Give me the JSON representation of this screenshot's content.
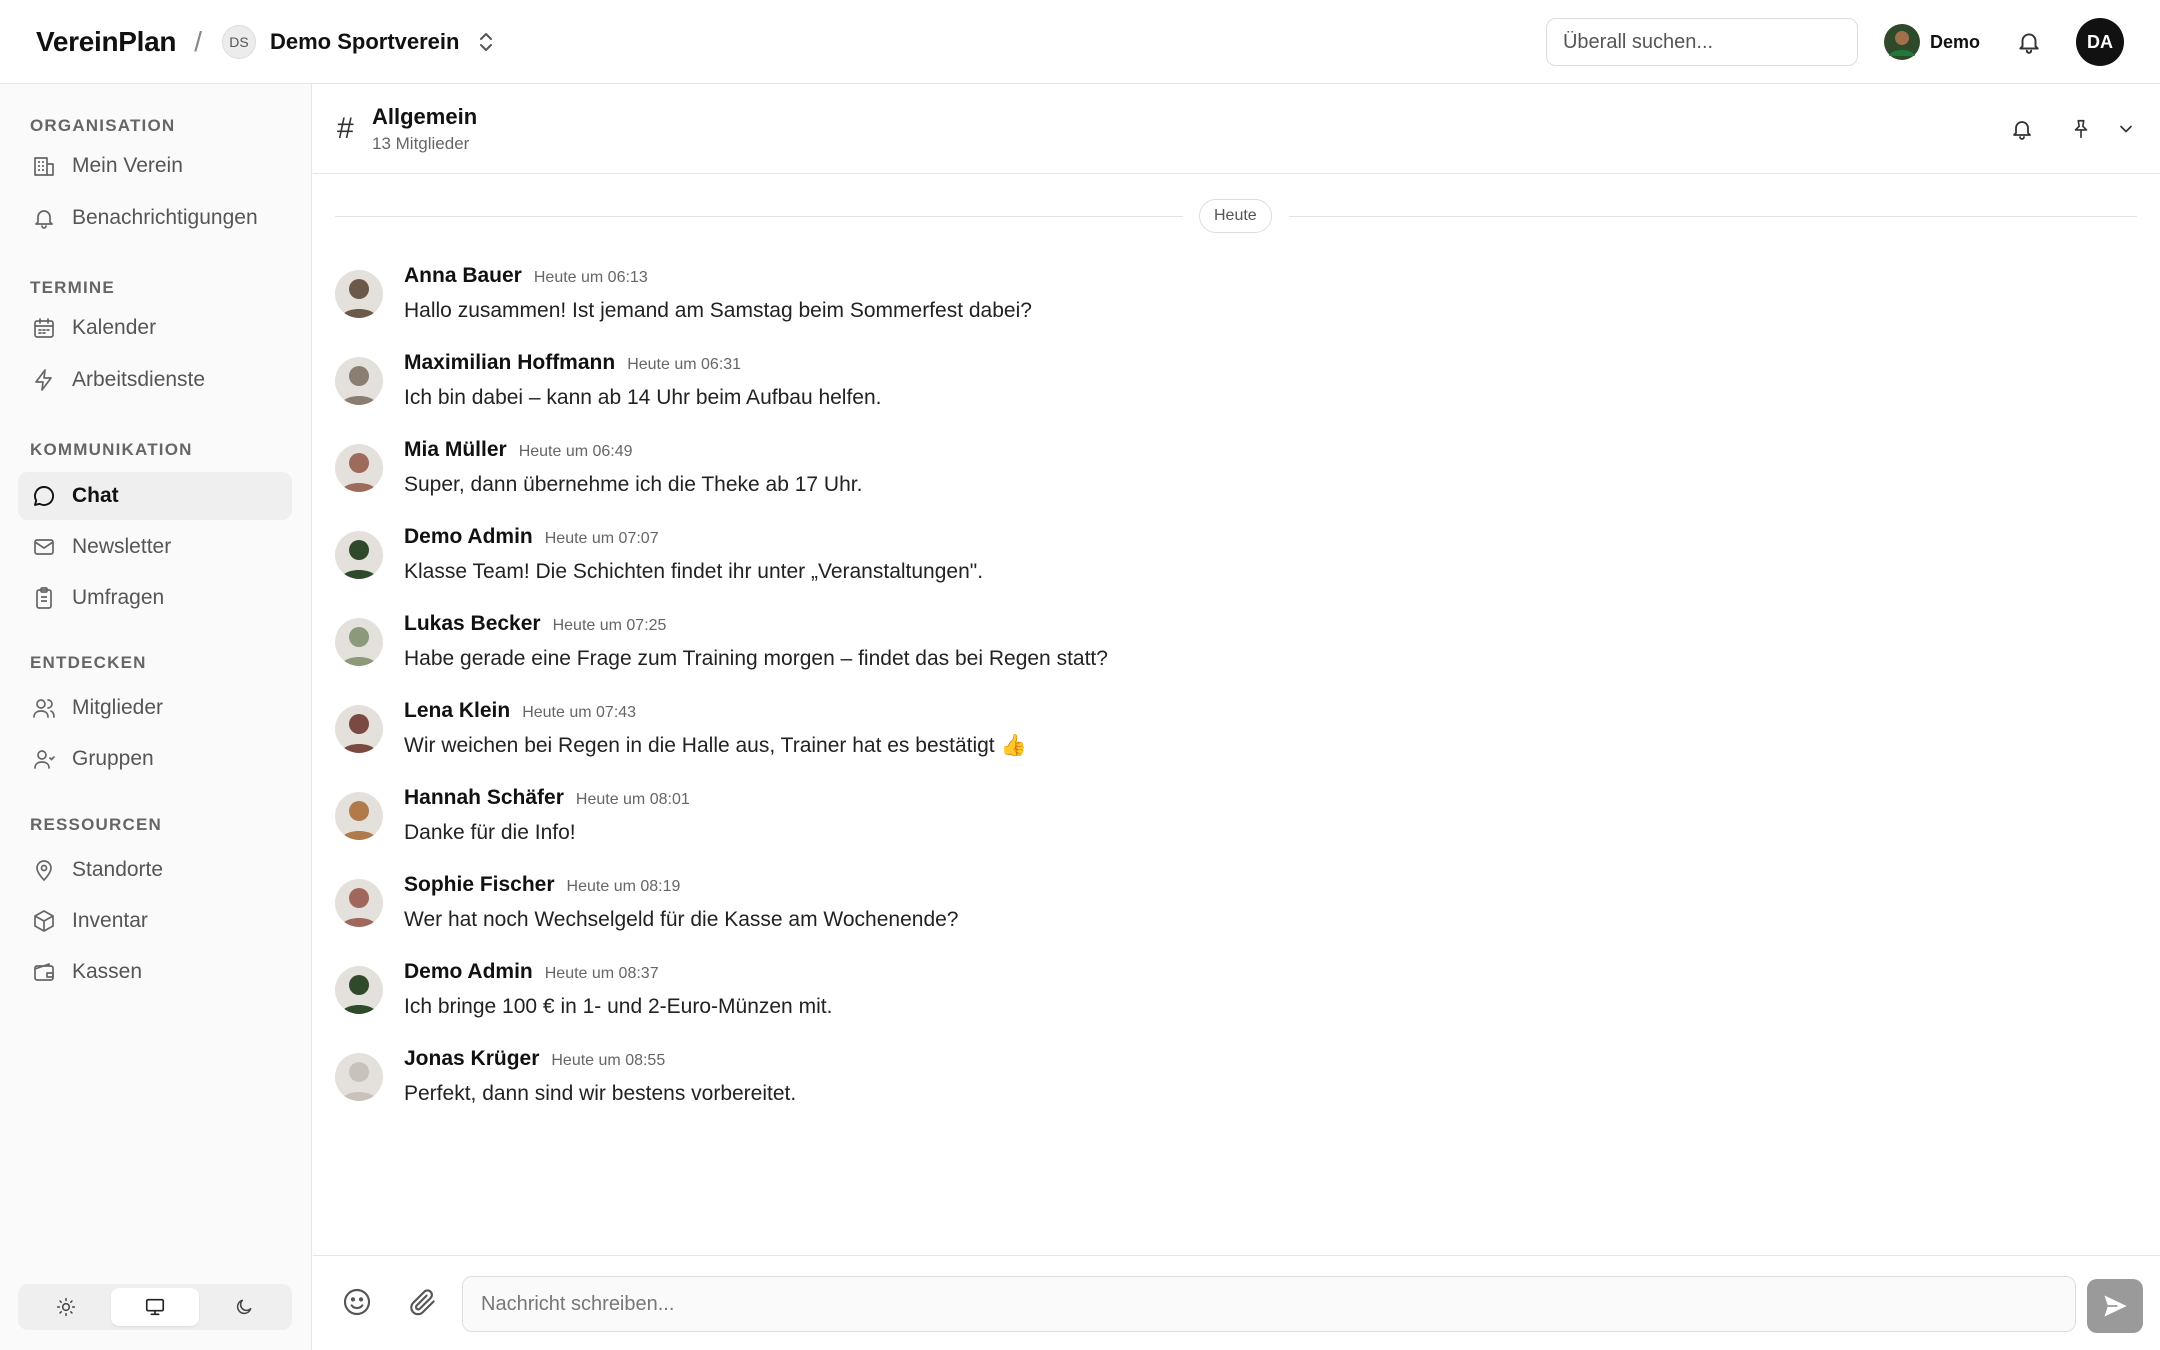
{
  "header": {
    "brand": "VereinPlan",
    "separator": "/",
    "org_badge": "DS",
    "org_name": "Demo Sportverein",
    "search_placeholder": "Überall suchen...",
    "user_name": "Demo",
    "user_initials": "DA"
  },
  "sidebar": {
    "sections": [
      {
        "label": "ORGANISATION",
        "items": [
          {
            "label": "Mein Verein",
            "icon": "building-icon"
          },
          {
            "label": "Benachrichtigungen",
            "icon": "bell-icon"
          }
        ]
      },
      {
        "label": "TERMINE",
        "items": [
          {
            "label": "Kalender",
            "icon": "calendar-icon"
          },
          {
            "label": "Arbeitsdienste",
            "icon": "lightning-icon"
          }
        ]
      },
      {
        "label": "KOMMUNIKATION",
        "items": [
          {
            "label": "Chat",
            "icon": "chat-bubble-icon",
            "active": true
          },
          {
            "label": "Newsletter",
            "icon": "mail-icon"
          },
          {
            "label": "Umfragen",
            "icon": "clipboard-icon"
          }
        ]
      },
      {
        "label": "ENTDECKEN",
        "items": [
          {
            "label": "Mitglieder",
            "icon": "users-icon"
          },
          {
            "label": "Gruppen",
            "icon": "group-icon"
          }
        ]
      },
      {
        "label": "RESSOURCEN",
        "items": [
          {
            "label": "Standorte",
            "icon": "map-pin-icon"
          },
          {
            "label": "Inventar",
            "icon": "box-icon"
          },
          {
            "label": "Kassen",
            "icon": "wallet-icon"
          }
        ]
      }
    ],
    "theme_modes": [
      "light",
      "system",
      "dark"
    ],
    "theme_active": "system"
  },
  "channel": {
    "hash": "#",
    "name": "Allgemein",
    "members": "13 Mitglieder"
  },
  "day_label": "Heute",
  "messages": [
    {
      "author": "Anna Bauer",
      "time": "Heute um 06:13",
      "text": "Hallo zusammen! Ist jemand am Samstag beim Sommerfest dabei?",
      "avatar_color": "#6b5a4a"
    },
    {
      "author": "Maximilian Hoffmann",
      "time": "Heute um 06:31",
      "text": "Ich bin dabei – kann ab 14 Uhr beim Aufbau helfen.",
      "avatar_color": "#8a7d72"
    },
    {
      "author": "Mia Müller",
      "time": "Heute um 06:49",
      "text": "Super, dann übernehme ich die Theke ab 17 Uhr.",
      "avatar_color": "#9c6b5c"
    },
    {
      "author": "Demo Admin",
      "time": "Heute um 07:07",
      "text": "Klasse Team! Die Schichten findet ihr unter „Veranstaltungen\".",
      "avatar_color": "#2f4a2a"
    },
    {
      "author": "Lukas Becker",
      "time": "Heute um 07:25",
      "text": "Habe gerade eine Frage zum Training morgen – findet das bei Regen statt?",
      "avatar_color": "#8a9a7a"
    },
    {
      "author": "Lena Klein",
      "time": "Heute um 07:43",
      "text": "Wir weichen bei Regen in die Halle aus, Trainer hat es bestätigt 👍",
      "avatar_color": "#7a4a40"
    },
    {
      "author": "Hannah Schäfer",
      "time": "Heute um 08:01",
      "text": "Danke für die Info!",
      "avatar_color": "#b07a4a"
    },
    {
      "author": "Sophie Fischer",
      "time": "Heute um 08:19",
      "text": "Wer hat noch Wechselgeld für die Kasse am Wochenende?",
      "avatar_color": "#a0685c"
    },
    {
      "author": "Demo Admin",
      "time": "Heute um 08:37",
      "text": "Ich bringe 100 € in 1- und 2-Euro-Münzen mit.",
      "avatar_color": "#2f4a2a"
    },
    {
      "author": "Jonas Krüger",
      "time": "Heute um 08:55",
      "text": "Perfekt, dann sind wir bestens vorbereitet.",
      "avatar_color": "#c9c2ba"
    }
  ],
  "composer": {
    "placeholder": "Nachricht schreiben..."
  }
}
